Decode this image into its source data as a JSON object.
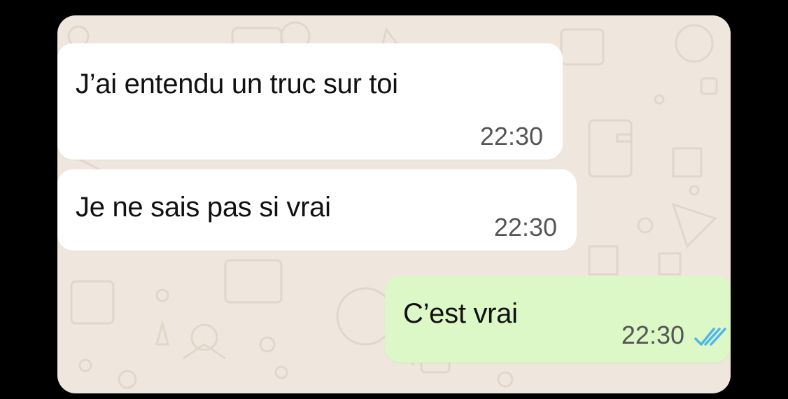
{
  "conversation": {
    "messages": [
      {
        "direction": "incoming",
        "text": "J’ai entendu un truc sur toi",
        "time": "22:30"
      },
      {
        "direction": "incoming",
        "text": "Je ne sais pas si vrai",
        "time": "22:30"
      },
      {
        "direction": "outgoing",
        "text": "C’est vrai",
        "time": "22:30",
        "status_icon": "double-check-read-icon"
      }
    ]
  },
  "colors": {
    "frame": "#000000",
    "chat_background": "#efe7de",
    "incoming_bubble": "#ffffff",
    "outgoing_bubble": "#dcf8c6",
    "read_ticks": "#4fb6ec"
  }
}
